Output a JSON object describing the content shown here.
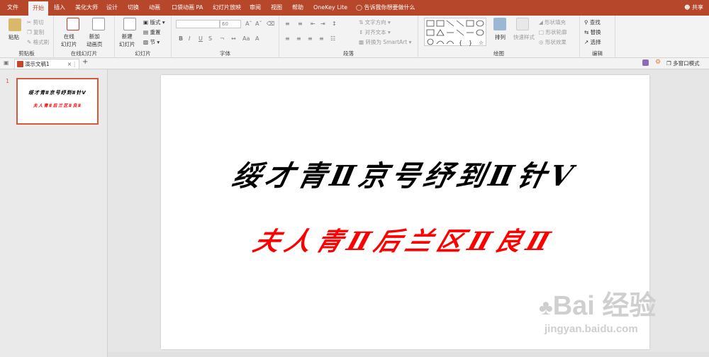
{
  "tabs": [
    "文件",
    "开始",
    "插入",
    "美化大师",
    "设计",
    "切换",
    "动画",
    "口袋动画 PA",
    "幻灯片放映",
    "审阅",
    "视图",
    "帮助",
    "OneKey Lite"
  ],
  "tell_me": "告诉我你想要做什么",
  "share": "共享",
  "clipboard": {
    "paste": "粘贴",
    "cut": "剪切",
    "copy": "复制",
    "format": "格式刷",
    "label": "剪贴板"
  },
  "online": {
    "online_slide": "在线\n幻灯片",
    "new_anim_page": "新加\n动画页",
    "label": "在线幻灯片"
  },
  "slides": {
    "new_slide": "新建\n幻灯片",
    "layout": "版式",
    "reset": "重置",
    "section": "节",
    "label": "幻灯片"
  },
  "font": {
    "name_value": "",
    "size_value": "60",
    "bold": "B",
    "italic": "I",
    "underline": "U",
    "strike": "S",
    "label": "字体"
  },
  "paragraph": {
    "text_dir": "文字方向",
    "align_text": "对齐文本",
    "smartart": "转换为 SmartArt",
    "label": "段落"
  },
  "drawing": {
    "arrange": "排列",
    "quick_styles": "快速样式",
    "fill": "形状填充",
    "outline": "形状轮廓",
    "effect": "形状效果",
    "label": "绘图"
  },
  "editing": {
    "find": "查找",
    "replace": "替换",
    "select": "选择",
    "label": "编辑"
  },
  "doc_tab": "演示文稿1",
  "multi_window": "多窗口模式",
  "slide_number": "1",
  "slide_rows": {
    "row1": "绥才青Ⅱ京号纾到Ⅱ针Ⅴ",
    "row2": "夫人青Ⅱ后兰区Ⅱ良Ⅱ"
  },
  "watermark": {
    "brand": "Bai 经验",
    "url": "jingyan.baidu.com"
  },
  "colors": {
    "accent": "#b7472a",
    "row2": "#ff0000"
  }
}
